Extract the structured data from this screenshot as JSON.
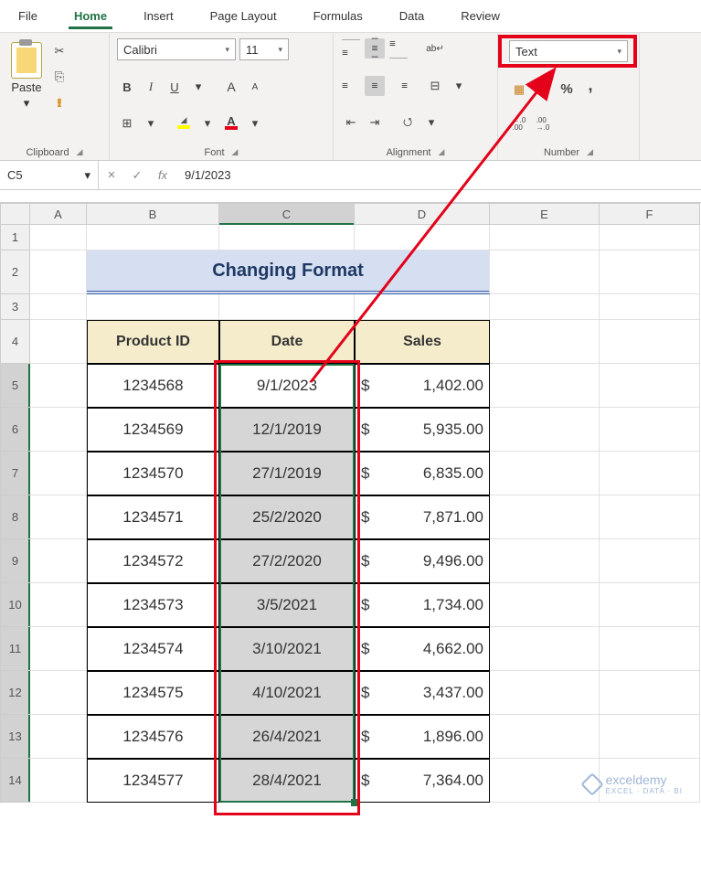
{
  "menubar": {
    "file": "File",
    "home": "Home",
    "insert": "Insert",
    "page_layout": "Page Layout",
    "formulas": "Formulas",
    "data": "Data",
    "review": "Review"
  },
  "ribbon": {
    "clipboard": {
      "paste": "Paste",
      "label": "Clipboard"
    },
    "font": {
      "name": "Calibri",
      "size": "11",
      "bold": "B",
      "italic": "I",
      "underline": "U",
      "label": "Font"
    },
    "alignment": {
      "label": "Alignment"
    },
    "number": {
      "format": "Text",
      "label": "Number"
    }
  },
  "formula_bar": {
    "namebox": "C5",
    "fx": "fx",
    "value": "9/1/2023"
  },
  "columns": [
    "A",
    "B",
    "C",
    "D",
    "E",
    "F"
  ],
  "rows": [
    "1",
    "2",
    "3",
    "4",
    "5",
    "6",
    "7",
    "8",
    "9",
    "10",
    "11",
    "12",
    "13",
    "14"
  ],
  "title": "Changing Format",
  "headers": {
    "pid": "Product ID",
    "date": "Date",
    "sales": "Sales"
  },
  "data": [
    {
      "pid": "1234568",
      "date": "9/1/2023",
      "cur": "$",
      "sales": "1,402.00"
    },
    {
      "pid": "1234569",
      "date": "12/1/2019",
      "cur": "$",
      "sales": "5,935.00"
    },
    {
      "pid": "1234570",
      "date": "27/1/2019",
      "cur": "$",
      "sales": "6,835.00"
    },
    {
      "pid": "1234571",
      "date": "25/2/2020",
      "cur": "$",
      "sales": "7,871.00"
    },
    {
      "pid": "1234572",
      "date": "27/2/2020",
      "cur": "$",
      "sales": "9,496.00"
    },
    {
      "pid": "1234573",
      "date": "3/5/2021",
      "cur": "$",
      "sales": "1,734.00"
    },
    {
      "pid": "1234574",
      "date": "3/10/2021",
      "cur": "$",
      "sales": "4,662.00"
    },
    {
      "pid": "1234575",
      "date": "4/10/2021",
      "cur": "$",
      "sales": "3,437.00"
    },
    {
      "pid": "1234576",
      "date": "26/4/2021",
      "cur": "$",
      "sales": "1,896.00"
    },
    {
      "pid": "1234577",
      "date": "28/4/2021",
      "cur": "$",
      "sales": "7,364.00"
    }
  ],
  "watermark": {
    "brand": "exceldemy",
    "tag": "EXCEL · DATA · BI"
  }
}
